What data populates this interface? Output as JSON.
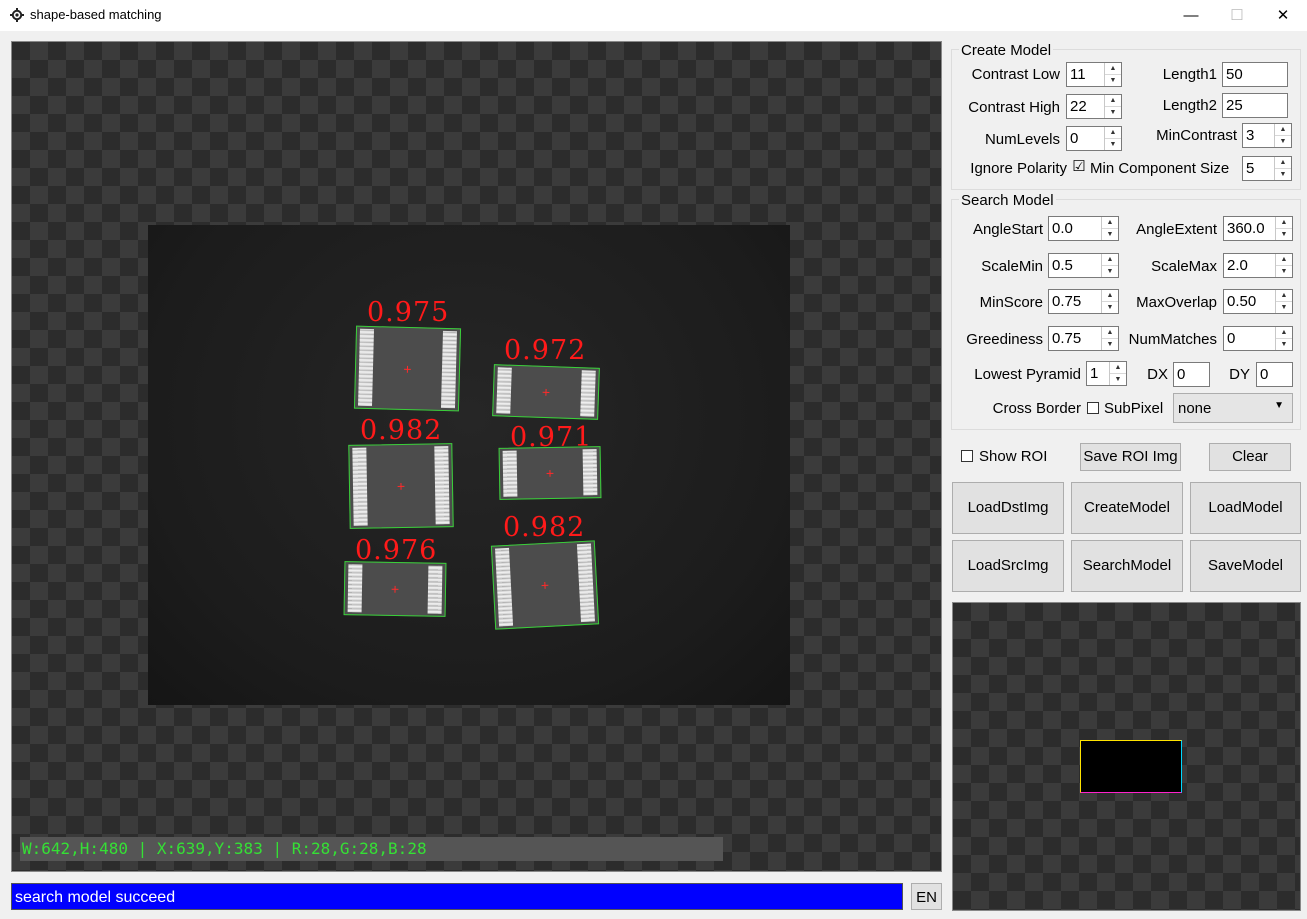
{
  "window": {
    "title": "shape-based matching",
    "minimize": "—",
    "maximize": "☐",
    "close": "✕"
  },
  "viewer": {
    "info": "W:642,H:480 | X:639,Y:383 | R:28,G:28,B:28",
    "scores": [
      "0.975",
      "0.972",
      "0.982",
      "0.971",
      "0.976",
      "0.982"
    ]
  },
  "status": {
    "message": "search model succeed",
    "lang": "EN"
  },
  "create_model": {
    "title": "Create Model",
    "contrast_low_label": "Contrast Low",
    "contrast_low": "11",
    "length1_label": "Length1",
    "length1": "50",
    "contrast_high_label": "Contrast High",
    "contrast_high": "22",
    "length2_label": "Length2",
    "length2": "25",
    "num_levels_label": "NumLevels",
    "num_levels": "0",
    "min_contrast_label": "MinContrast",
    "min_contrast": "3",
    "ignore_polarity_label": "Ignore Polarity",
    "ignore_polarity_checked": "☑",
    "min_component_size_label": "Min Component Size",
    "min_component_size": "5"
  },
  "search_model": {
    "title": "Search Model",
    "angle_start_label": "AngleStart",
    "angle_start": "0.0",
    "angle_extent_label": "AngleExtent",
    "angle_extent": "360.0",
    "scale_min_label": "ScaleMin",
    "scale_min": "0.5",
    "scale_max_label": "ScaleMax",
    "scale_max": "2.0",
    "min_score_label": "MinScore",
    "min_score": "0.75",
    "max_overlap_label": "MaxOverlap",
    "max_overlap": "0.50",
    "greediness_label": "Greediness",
    "greediness": "0.75",
    "num_matches_label": "NumMatches",
    "num_matches": "0",
    "lowest_pyramid_label": "Lowest Pyramid",
    "lowest_pyramid": "1",
    "dx_label": "DX",
    "dx": "0",
    "dy_label": "DY",
    "dy": "0",
    "cross_border_label": "Cross Border",
    "subpixel_label": "SubPixel",
    "subpixel_value": "none"
  },
  "actions": {
    "show_roi_label": "Show ROI",
    "save_roi_img": "Save ROI Img",
    "clear": "Clear",
    "load_dst_img": "LoadDstImg",
    "create_model": "CreateModel",
    "load_model": "LoadModel",
    "load_src_img": "LoadSrcImg",
    "search_model": "SearchModel",
    "save_model": "SaveModel"
  },
  "colors": {
    "status_bg": "#0000ff",
    "match_outline": "#39d039",
    "score_text": "#ff1a1a",
    "info_text": "#35e035"
  }
}
